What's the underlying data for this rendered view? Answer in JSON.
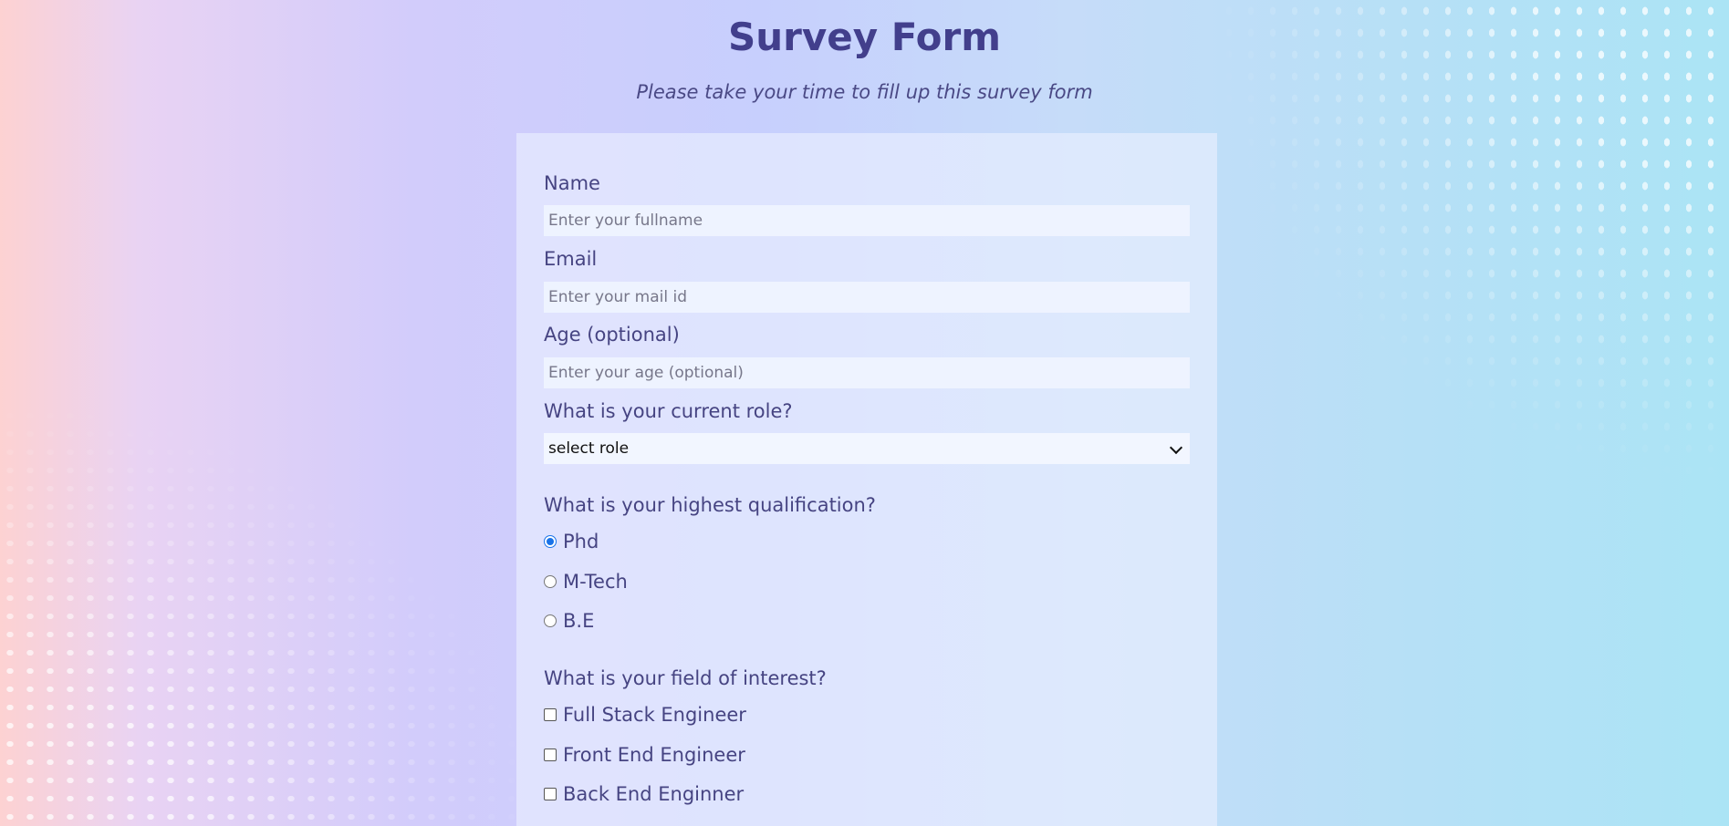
{
  "header": {
    "title": "Survey Form",
    "subtitle": "Please take your time to fill up this survey form"
  },
  "form": {
    "name": {
      "label": "Name",
      "placeholder": "Enter your fullname",
      "value": ""
    },
    "email": {
      "label": "Email",
      "placeholder": "Enter your mail id",
      "value": ""
    },
    "age": {
      "label": "Age (optional)",
      "placeholder": "Enter your age (optional)",
      "value": ""
    },
    "role": {
      "label": "What is your current role?",
      "selected": "select role"
    },
    "qualification": {
      "label": "What is your highest qualification?",
      "options": [
        {
          "label": "Phd",
          "checked": true
        },
        {
          "label": "M-Tech",
          "checked": false
        },
        {
          "label": "B.E",
          "checked": false
        }
      ]
    },
    "interest": {
      "label": "What is your field of interest?",
      "options": [
        {
          "label": "Full Stack Engineer",
          "checked": false
        },
        {
          "label": "Front End Engineer",
          "checked": false
        },
        {
          "label": "Back End Enginner",
          "checked": false
        }
      ]
    }
  },
  "colors": {
    "title": "#423f8c",
    "text": "#464482",
    "radio_accent": "#1a73e8"
  }
}
